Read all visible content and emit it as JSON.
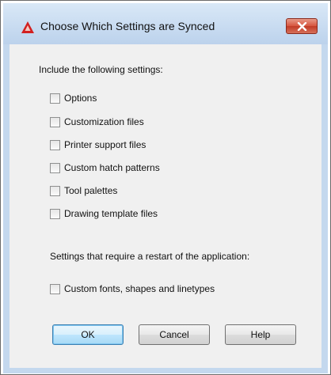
{
  "dialog": {
    "title": "Choose Which Settings are Synced"
  },
  "section1": {
    "heading": "Include the following settings:",
    "options": [
      {
        "label": "Options",
        "checked": false
      },
      {
        "label": "Customization files",
        "checked": false
      },
      {
        "label": "Printer support files",
        "checked": false
      },
      {
        "label": "Custom hatch patterns",
        "checked": false
      },
      {
        "label": "Tool palettes",
        "checked": false
      },
      {
        "label": "Drawing template files",
        "checked": false
      }
    ]
  },
  "section2": {
    "heading": "Settings that require a restart of the application:",
    "options": [
      {
        "label": "Custom fonts, shapes and linetypes",
        "checked": false
      }
    ]
  },
  "buttons": {
    "ok": "OK",
    "cancel": "Cancel",
    "help": "Help"
  },
  "colors": {
    "title_bar": "#c9dcf1",
    "close_button": "#c9452f",
    "app_icon": "#d22020",
    "client_background": "#f0f0f0"
  },
  "icons": {
    "app": "autocad-triangle-icon",
    "close": "close-icon"
  }
}
